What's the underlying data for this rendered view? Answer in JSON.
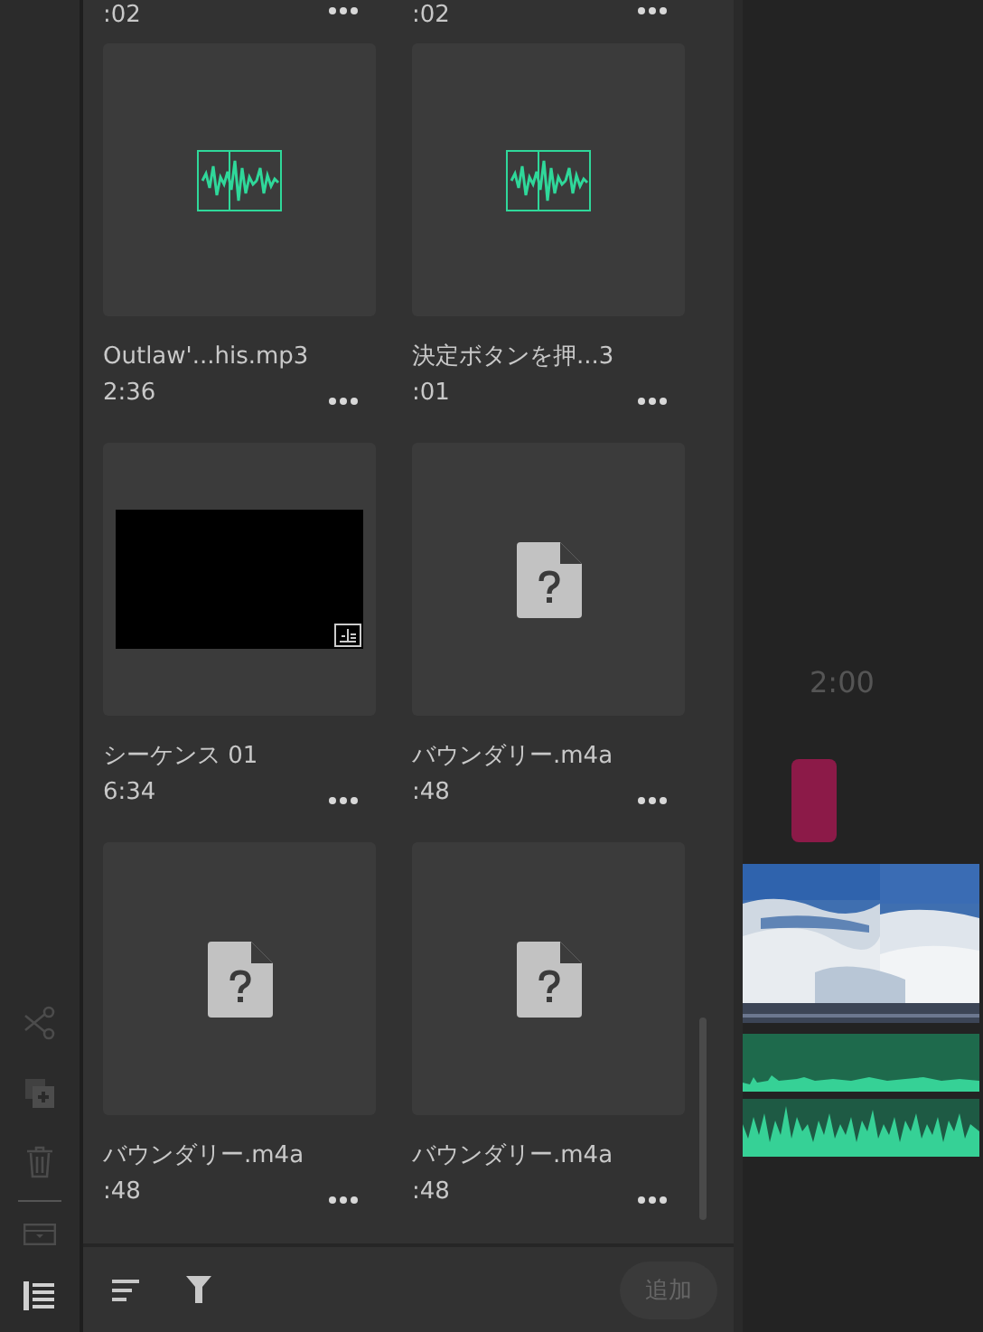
{
  "tools": [
    {
      "kind": "cut",
      "disabled": true
    },
    {
      "kind": "duplicate",
      "disabled": true
    },
    {
      "kind": "delete",
      "disabled": true
    },
    {
      "kind": "split",
      "disabled": true
    },
    {
      "kind": "panel",
      "disabled": false
    }
  ],
  "top_row": [
    {
      "duration": ":02"
    },
    {
      "duration": ":02"
    }
  ],
  "clips": [
    {
      "kind": "audio",
      "name": "Outlaw'...his.mp3",
      "duration": "2:36"
    },
    {
      "kind": "audio",
      "name": "決定ボタンを押...3",
      "duration": ":01"
    },
    {
      "kind": "sequence",
      "name": "シーケンス 01",
      "duration": "6:34"
    },
    {
      "kind": "unknown",
      "name": "バウンダリー.m4a",
      "duration": ":48"
    },
    {
      "kind": "unknown",
      "name": "バウンダリー.m4a",
      "duration": ":48"
    },
    {
      "kind": "unknown",
      "name": "バウンダリー.m4a",
      "duration": ":48"
    }
  ],
  "add_button": {
    "label": "追加",
    "disabled": true
  },
  "timeline": {
    "time": "2:00"
  }
}
